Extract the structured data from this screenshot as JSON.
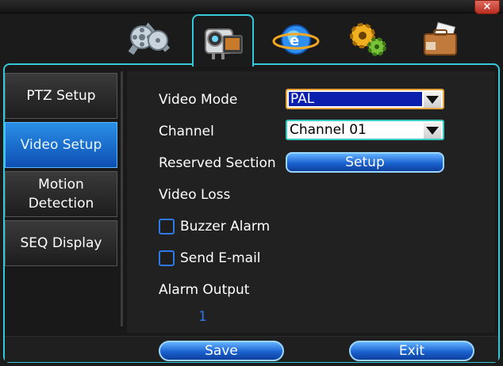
{
  "window": {
    "close_label": "×"
  },
  "top_tabs": [
    {
      "icon": "film-reel-icon"
    },
    {
      "icon": "camera-icon",
      "selected": true
    },
    {
      "icon": "network-globe-icon"
    },
    {
      "icon": "gears-icon"
    },
    {
      "icon": "briefcase-icon"
    }
  ],
  "sidebar": {
    "items": [
      {
        "label": "PTZ Setup"
      },
      {
        "label": "Video Setup",
        "active": true
      },
      {
        "label": "Motion Detection"
      },
      {
        "label": "SEQ Display"
      }
    ]
  },
  "form": {
    "video_mode": {
      "label": "Video Mode",
      "value": "PAL"
    },
    "channel": {
      "label": "Channel",
      "value": "Channel 01"
    },
    "reserved_section": {
      "label": "Reserved Section",
      "button_label": "Setup"
    },
    "video_loss": {
      "label": "Video Loss"
    },
    "buzzer_alarm": {
      "label": "Buzzer Alarm",
      "checked": false
    },
    "send_email": {
      "label": "Send E-mail",
      "checked": false
    },
    "alarm_output": {
      "label": "Alarm Output",
      "value": "1"
    }
  },
  "footer": {
    "save_label": "Save",
    "exit_label": "Exit"
  },
  "colors": {
    "accent_border": "#35c8d8",
    "active_blue": "#1a62cf",
    "focus_orange": "#e7a43a"
  }
}
